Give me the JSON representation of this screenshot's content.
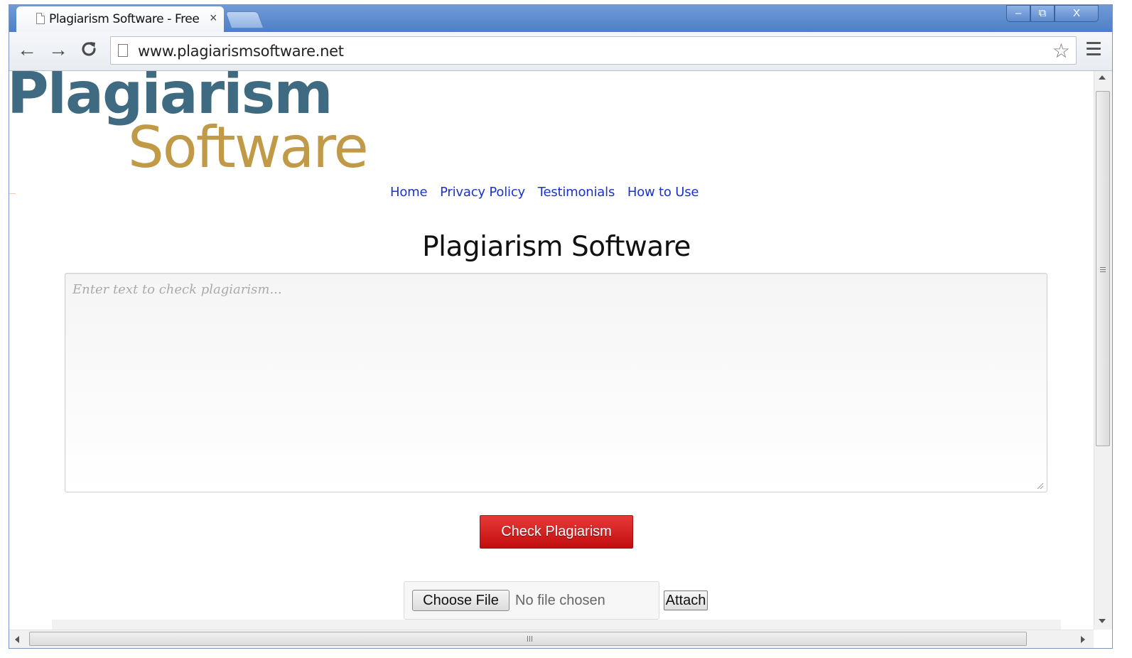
{
  "browser": {
    "tab_title": "Plagiarism Software - Free",
    "tab_close": "×",
    "url": "www.plagiarismsoftware.net",
    "window_minimize": "–",
    "window_restore": "⧉",
    "window_close": "X",
    "back": "←",
    "forward": "→",
    "reload": "C",
    "bookmark_star": "☆"
  },
  "logo": {
    "line1": "Plagiarism",
    "line2": "Software",
    "line1_color": "#3e6a82",
    "line2_color": "#c19a47"
  },
  "nav": {
    "items": [
      {
        "label": "Home"
      },
      {
        "label": "Privacy Policy"
      },
      {
        "label": "Testimonials"
      },
      {
        "label": "How to Use"
      }
    ],
    "link_color": "#1a34c9"
  },
  "main": {
    "heading": "Plagiarism Software",
    "textarea_placeholder": "Enter text to check plagiarism...",
    "check_button": "Check Plagiarism",
    "check_button_color": "#d21a1a",
    "choose_file": "Choose File",
    "no_file": "No file chosen",
    "attach": "Attach"
  },
  "icons": {
    "tab_page": "page-icon",
    "omnibox_page": "page-icon",
    "star": "star-icon",
    "menu": "hamburger-menu-icon"
  }
}
